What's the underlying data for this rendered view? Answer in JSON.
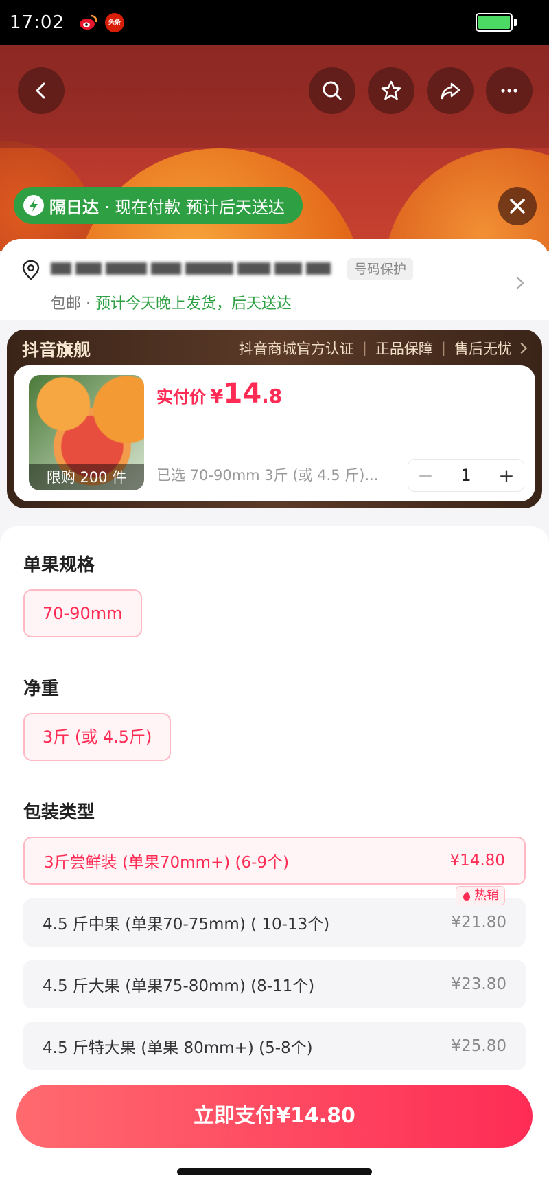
{
  "status_bar": {
    "time": "17:02",
    "battery_level": 1.0,
    "toutiao_badge": "头条"
  },
  "delivery_banner": {
    "strong": "隔日达",
    "text": "· 现在付款 预计后天送达"
  },
  "address": {
    "phone_protect": "号码保护",
    "shipping_prefix": "包邮 · ",
    "shipping_estimate": "预计今天晚上发货，后天送达"
  },
  "store": {
    "name": "抖音旗舰",
    "badges": [
      "抖音商城官方认证",
      "正品保障",
      "售后无忧"
    ]
  },
  "product": {
    "limit": "限购 200 件",
    "price_label": "实付价",
    "price_symbol": "¥",
    "price_int": "14",
    "price_dec": ".8",
    "selected_summary": "已选 70-90mm 3斤 (或 4.5 斤)...",
    "quantity": "1",
    "minus": "−",
    "plus": "+"
  },
  "options": {
    "size_title": "单果规格",
    "size_value": "70-90mm",
    "weight_title": "净重",
    "weight_value": "3斤 (或 4.5斤)",
    "package_title": "包装类型",
    "packages": [
      {
        "name": "3斤尝鲜装 (单果70mm+) (6-9个)",
        "price": "¥14.80"
      },
      {
        "name": "4.5 斤中果 (单果70-75mm) ( 10-13个)",
        "price": "¥21.80"
      },
      {
        "name": "4.5 斤大果 (单果75-80mm) (8-11个)",
        "price": "¥23.80"
      },
      {
        "name": "4.5 斤特大果 (单果 80mm+) (5-8个)",
        "price": "¥25.80"
      }
    ],
    "hot_label": "热销"
  },
  "pay_button": "立即支付¥14.80",
  "colors": {
    "accent": "#fe2c55",
    "green": "#2ea043",
    "store_dark": "#3a2418"
  }
}
